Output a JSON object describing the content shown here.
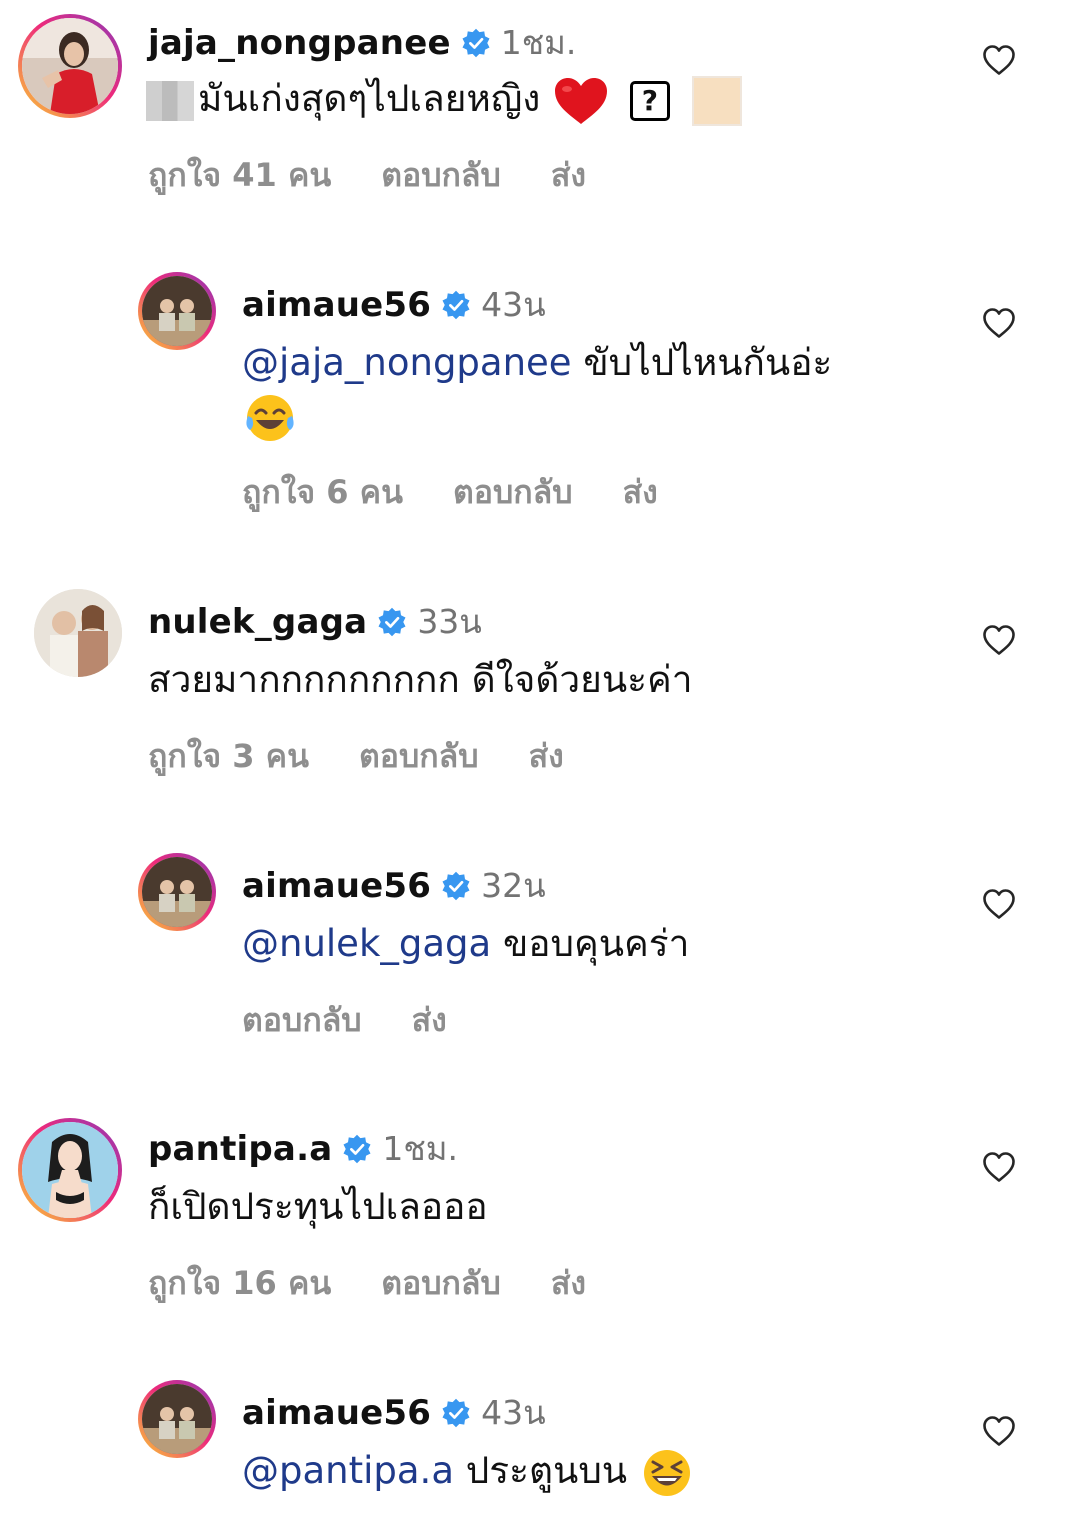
{
  "comments": [
    {
      "username": "jaja_nongpanee",
      "time": "1ชม.",
      "text": "มันเก่งสุดๆไปเลยหญิง",
      "likes": "ถูกใจ 41 คน",
      "reply": "ตอบกลับ",
      "send": "ส่ง"
    },
    {
      "username": "aimaue56",
      "time": "43น",
      "mention": "@jaja_nongpanee",
      "text": " ขับไปไหนกันอ่ะ",
      "likes": "ถูกใจ 6 คน",
      "reply": "ตอบกลับ",
      "send": "ส่ง"
    },
    {
      "username": "nulek_gaga",
      "time": "33น",
      "text": "สวยมากกกกกกกกก ดีใจด้วยนะค่า",
      "likes": "ถูกใจ 3 คน",
      "reply": "ตอบกลับ",
      "send": "ส่ง"
    },
    {
      "username": "aimaue56",
      "time": "32น",
      "mention": "@nulek_gaga",
      "text": " ขอบคุนคร่า",
      "reply": "ตอบกลับ",
      "send": "ส่ง"
    },
    {
      "username": "pantipa.a",
      "time": "1ชม.",
      "text": "ก็เปิดประทุนไปเลอออ",
      "likes": "ถูกใจ 16 คน",
      "reply": "ตอบกลับ",
      "send": "ส่ง"
    },
    {
      "username": "aimaue56",
      "time": "43น",
      "mention": "@pantipa.a",
      "text": " ประตูนบน"
    }
  ],
  "icons": {
    "verified": "verified-badge-icon",
    "like": "heart-outline-icon",
    "unknown_glyph": "?"
  },
  "colors": {
    "verified": "#3897f0",
    "mention": "#1f3a8a",
    "meta": "#8e8e8e",
    "story_ring_start": "#f9ce34",
    "story_ring_end": "#8a3ab9"
  }
}
